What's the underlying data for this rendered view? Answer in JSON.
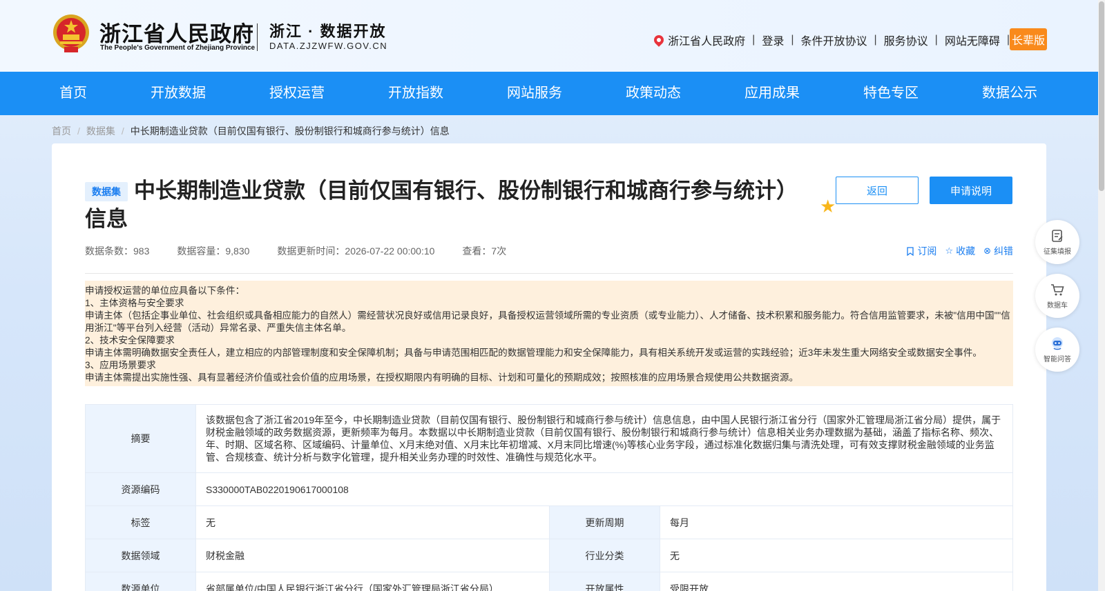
{
  "header": {
    "gov_title": "浙江省人民政府",
    "gov_subtitle": "The People's Government of Zhejiang Province",
    "portal_title": "浙江 · 数据开放",
    "portal_domain": "DATA.ZJZWFW.GOV.CN",
    "links": [
      "浙江省人民政府",
      "登录",
      "条件开放协议",
      "服务协议",
      "网站无障碍"
    ],
    "elder_label": "长辈版"
  },
  "nav": [
    "首页",
    "开放数据",
    "授权运营",
    "开放指数",
    "网站服务",
    "政策动态",
    "应用成果",
    "特色专区",
    "数据公示"
  ],
  "breadcrumb": [
    "首页",
    "数据集",
    "中长期制造业贷款（目前仅国有银行、股份制银行和城商行参与统计）信息"
  ],
  "dataset": {
    "tag": "数据集",
    "title": "中长期制造业贷款（目前仅国有银行、股份制银行和城商行参与统计）信息",
    "back_label": "返回",
    "apply_label": "申请说明",
    "meta": {
      "records": "数据条数：983",
      "capacity": "数据容量：9,830",
      "updated": "数据更新时间：2026-07-22 00:00:10",
      "views": "查看：7次"
    },
    "actions": [
      "订阅",
      "收藏",
      "纠错"
    ]
  },
  "notice": [
    "申请授权运营的单位应具备以下条件：",
    "1、主体资格与安全要求",
    "申请主体（包括企事业单位、社会组织或具备相应能力的自然人）需经营状况良好或信用记录良好，具备授权运营领域所需的专业资质（或专业能力）、人才储备、技术积累和服务能力。符合信用监管要求，未被\"信用中国\"\"信用浙江\"等平台列入经营（活动）异常名录、严重失信主体名单。",
    "2、技术安全保障要求",
    "申请主体需明确数据安全责任人，建立相应的内部管理制度和安全保障机制；具备与申请范围相匹配的数据管理能力和安全保障能力，具有相关系统开发或运营的实践经验；近3年未发生重大网络安全或数据安全事件。",
    "3、应用场景要求",
    "申请主体需提出实施性强、具有显著经济价值或社会价值的应用场景，在授权期限内有明确的目标、计划和可量化的预期成效；按照核准的应用场景合规使用公共数据资源。"
  ],
  "table": {
    "abstract_label": "摘要",
    "abstract": "该数据包含了浙江省2019年至今，中长期制造业贷款（目前仅国有银行、股份制银行和城商行参与统计）信息信息，由中国人民银行浙江省分行（国家外汇管理局浙江省分局）提供，属于财税金融领域的政务数据资源，更新频率为每月。本数据以中长期制造业贷款（目前仅国有银行、股份制银行和城商行参与统计）信息相关业务办理数据为基础，涵盖了指标名称、频次、年、时期、区域名称、区域编码、计量单位、X月末绝对值、X月末比年初增减、X月末同比增速(%)等核心业务字段，通过标准化数据归集与清洗处理，可有效支撑财税金融领域的业务监管、合规核查、统计分析与数字化管理，提升相关业务办理的时效性、准确性与规范化水平。",
    "code_label": "资源编码",
    "code": "S330000TAB0220190617000108",
    "tag_label": "标签",
    "tag": "无",
    "cycle_label": "更新周期",
    "cycle": "每月",
    "domain_label": "数据领域",
    "domain": "财税金融",
    "industry_label": "行业分类",
    "industry": "无",
    "unit_label": "数源单位",
    "unit": "省部属单位/中国人民银行浙江省分行（国家外汇管理局浙江省分局）",
    "open_label": "开放属性",
    "open": "受限开放"
  },
  "floating": [
    "征集填报",
    "数据车",
    "智能问答"
  ]
}
